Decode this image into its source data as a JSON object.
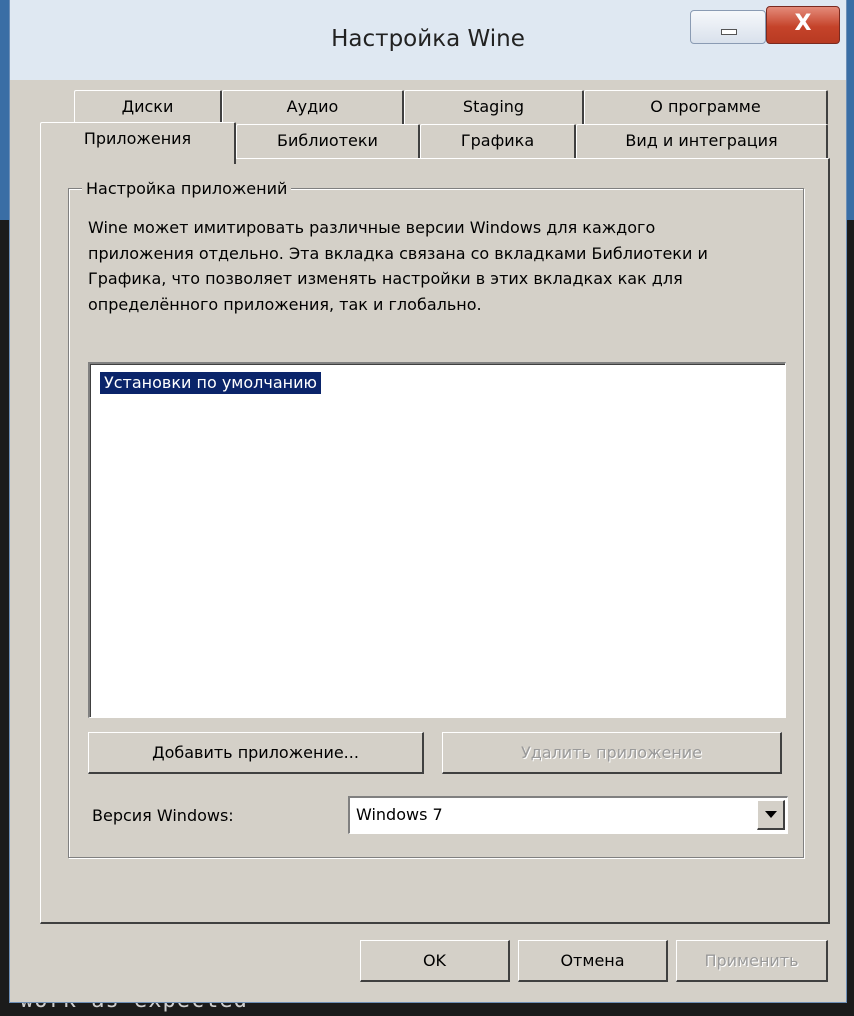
{
  "window": {
    "title": "Настройка Wine",
    "close_glyph": "X"
  },
  "tabs_row1": [
    {
      "label": "Диски"
    },
    {
      "label": "Аудио"
    },
    {
      "label": "Staging"
    },
    {
      "label": "О программе"
    }
  ],
  "tabs_row2": [
    {
      "label": "Приложения",
      "active": true
    },
    {
      "label": "Библиотеки"
    },
    {
      "label": "Графика"
    },
    {
      "label": "Вид и интеграция"
    }
  ],
  "group": {
    "title": "Настройка приложений",
    "description": "Wine может имитировать различные версии Windows для каждого приложения отдельно. Эта вкладка связана со вкладками Библиотеки и Графика, что позволяет изменять настройки в этих вкладках как для определённого приложения, так и глобально."
  },
  "app_list": {
    "items": [
      "Установки по умолчанию"
    ],
    "selected_index": 0
  },
  "buttons": {
    "add_app": "Добавить приложение...",
    "remove_app": "Удалить приложение",
    "ok": "OK",
    "cancel": "Отмена",
    "apply": "Применить"
  },
  "windows_version": {
    "label": "Версия Windows:",
    "value": "Windows 7"
  },
  "background_terminal_text": "work as expected"
}
